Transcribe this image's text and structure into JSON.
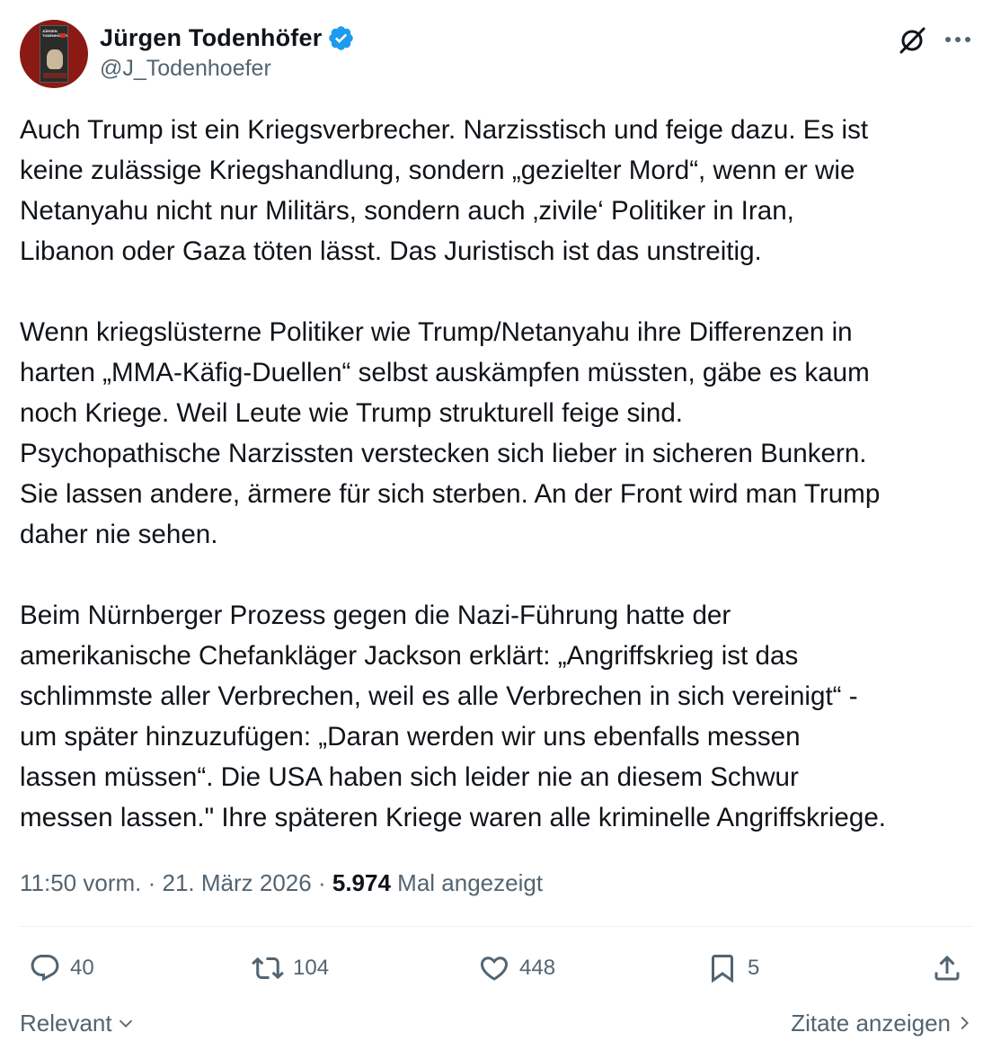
{
  "author": {
    "display_name": "Jürgen Todenhöfer",
    "handle": "@J_Todenhoefer",
    "avatar_book_title": "JÜRGEN TODENHÖFER",
    "verified_color": "#1d9bf0"
  },
  "header_icons": {
    "grok": "grok-icon",
    "more": "more-icon"
  },
  "tweet": {
    "paragraphs": [
      [
        "Auch Trump ist ein Kriegsverbrecher. Narzisstisch und feige dazu. Es ist",
        "keine zulässige Kriegshandlung, sondern „gezielter Mord“, wenn er wie",
        "Netanyahu nicht nur Militärs, sondern auch ‚zivile‘ Politiker in Iran,",
        "Libanon oder Gaza töten lässt. Das Juristisch ist das unstreitig."
      ],
      [
        "Wenn kriegslüsterne Politiker wie Trump/Netanyahu ihre Differenzen in",
        "harten „MMA-Käfig-Duellen“ selbst auskämpfen müssten, gäbe es kaum",
        "noch Kriege. Weil Leute wie Trump strukturell feige sind.",
        "Psychopathische Narzissten verstecken sich lieber in sicheren Bunkern.",
        "Sie lassen andere, ärmere für sich sterben. An der Front wird man Trump",
        "daher nie sehen."
      ],
      [
        "Beim Nürnberger Prozess gegen die Nazi-Führung hatte der",
        "amerikanische Chefankläger Jackson erklärt: „Angriffskrieg ist das",
        "schlimmste aller Verbrechen, weil es alle Verbrechen in sich vereinigt“ -",
        "um später hinzuzufügen: „Daran werden wir uns ebenfalls messen",
        "lassen müssen“. Die USA haben sich leider nie an diesem Schwur",
        "messen lassen.\" Ihre späteren Kriege waren alle kriminelle Angriffskriege."
      ]
    ]
  },
  "meta": {
    "time": "11:50 vorm.",
    "separator": "·",
    "date": "21. März 2026",
    "views": "5.974",
    "views_label": "Mal angezeigt"
  },
  "actions": {
    "replies": "40",
    "reposts": "104",
    "likes": "448",
    "bookmarks": "5",
    "share_icon": "share-icon"
  },
  "footer": {
    "sort_label": "Relevant",
    "quotes_label": "Zitate anzeigen"
  },
  "colors": {
    "text_primary": "#0f1419",
    "text_secondary": "#536471",
    "divider": "#eff3f4",
    "accent": "#1d9bf0"
  }
}
